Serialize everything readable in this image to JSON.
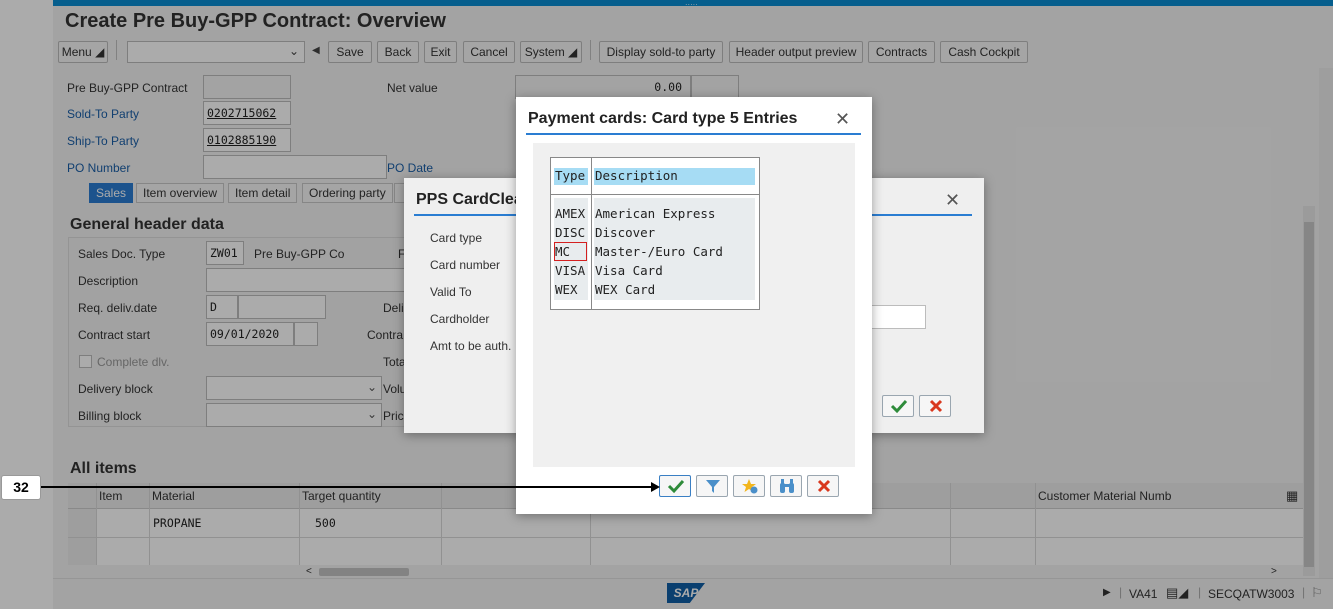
{
  "window": {
    "title": "Create Pre Buy-GPP Contract: Overview",
    "grip": "....."
  },
  "toolbar": {
    "menu": "Menu",
    "save": "Save",
    "back": "Back",
    "exit": "Exit",
    "cancel": "Cancel",
    "system": "System",
    "display_sold_to": "Display sold-to party",
    "header_output": "Header output preview",
    "contracts": "Contracts",
    "cash_cockpit": "Cash Cockpit"
  },
  "header": {
    "contract_label": "Pre Buy-GPP Contract",
    "net_value_label": "Net value",
    "net_value": "0.00",
    "sold_to_label": "Sold-To Party",
    "sold_to": "0202715062",
    "ship_to_label": "Ship-To Party",
    "ship_to": "0102885190",
    "po_number_label": "PO Number",
    "po_date_label": "PO Date"
  },
  "tabs": [
    "Sales",
    "Item overview",
    "Item detail",
    "Ordering party"
  ],
  "general": {
    "title": "General header data",
    "sales_doc_type_label": "Sales Doc. Type",
    "sales_doc_type": "ZW01",
    "sales_doc_type_desc": "Pre Buy-GPP Co",
    "description_label": "Description",
    "req_deliv_label": "Req. deliv.date",
    "req_deliv_unit": "D",
    "contract_start_label": "Contract start",
    "contract_start": "09/01/2020",
    "complete_dlv_label": "Complete dlv.",
    "delivery_block_label": "Delivery block",
    "billing_block_label": "Billing block",
    "right_col": [
      "F",
      "Deli",
      "Contra",
      "Tota",
      "Volu",
      "Pric"
    ]
  },
  "items": {
    "title": "All items",
    "columns": [
      "Item",
      "Material",
      "Target quantity",
      "Customer Material Numb"
    ],
    "rows": [
      {
        "item": "",
        "material": "PROPANE",
        "qty": "500"
      }
    ]
  },
  "status": {
    "tcode": "VA41",
    "system": "SECQATW3003",
    "logo": "SAP"
  },
  "pps_dialog": {
    "title": "PPS CardClea",
    "labels": [
      "Card type",
      "Card number",
      "Valid To",
      "Cardholder",
      "Amt to be auth."
    ]
  },
  "payment_dialog": {
    "title": "Payment cards: Card type 5 Entries",
    "col_type": "Type",
    "col_desc": "Description",
    "entries": [
      {
        "type": "AMEX",
        "desc": "American Express"
      },
      {
        "type": "DISC",
        "desc": "Discover"
      },
      {
        "type": "MC",
        "desc": "Master-/Euro Card"
      },
      {
        "type": "VISA",
        "desc": "Visa Card"
      },
      {
        "type": "WEX",
        "desc": "WEX Card"
      }
    ]
  },
  "annotation": {
    "number": "32"
  }
}
